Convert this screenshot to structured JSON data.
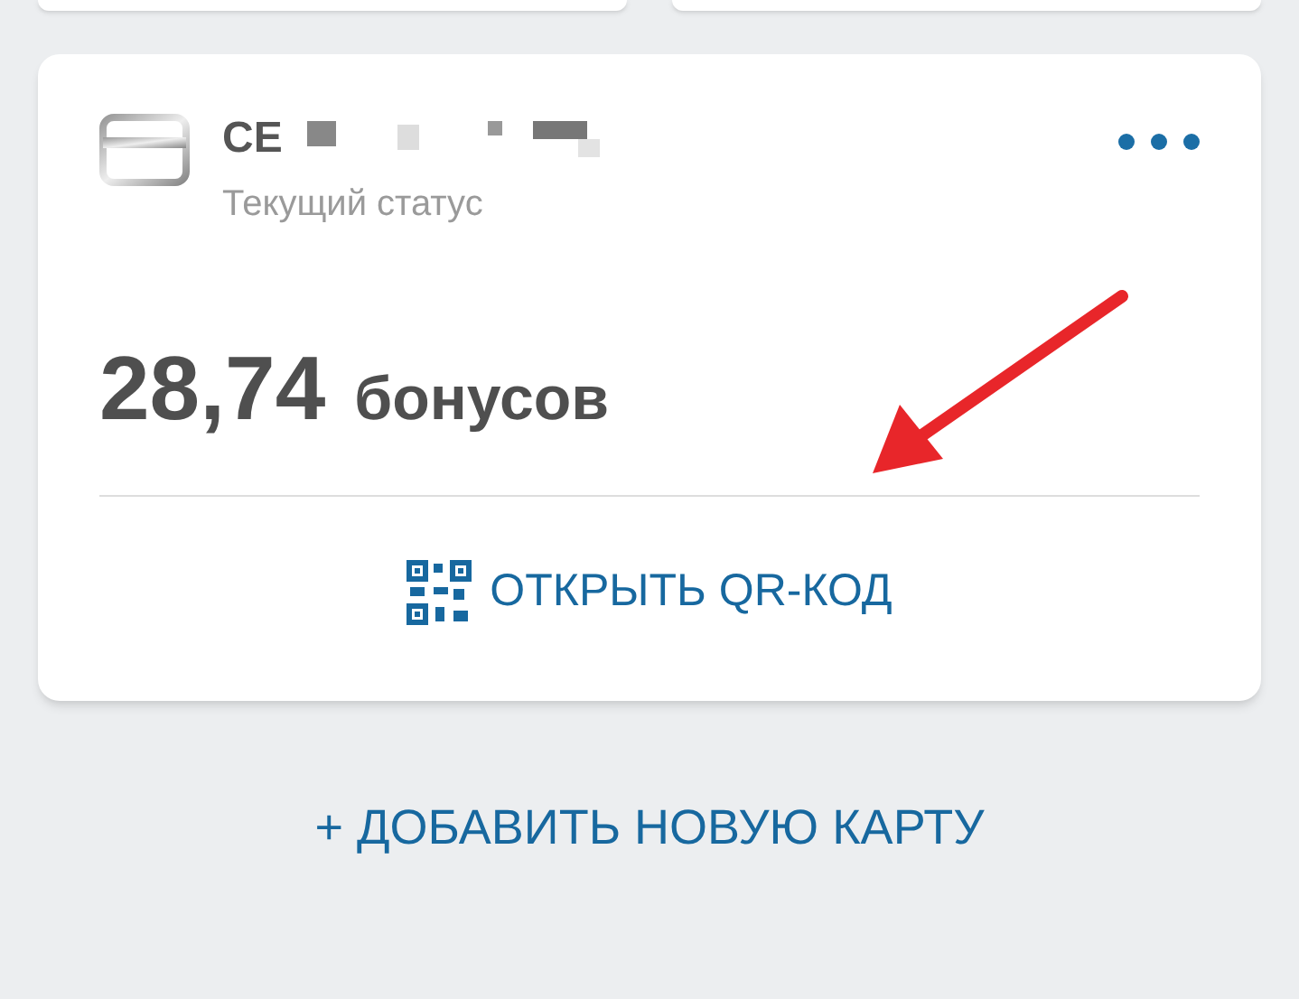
{
  "card": {
    "title": "СЕ",
    "subtitle": "Текущий статус",
    "amount": "28,74",
    "unit": "бонусов",
    "qr_button": "ОТКРЫТЬ QR-КОД"
  },
  "add_card_link": "+ ДОБАВИТЬ НОВУЮ КАРТУ"
}
